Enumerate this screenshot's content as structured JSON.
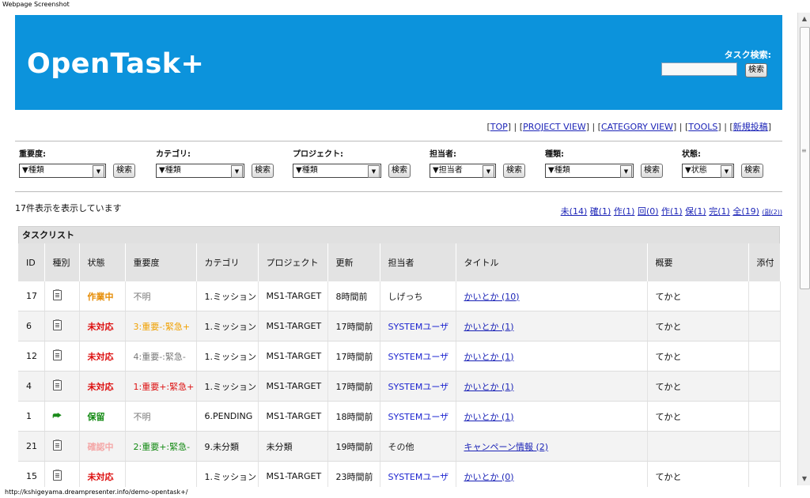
{
  "window": {
    "title": "Webpage Screenshot",
    "status_url": "http://kshigeyama.dreampresenter.info/demo-opentask+/"
  },
  "header": {
    "logo": "OpenTask+",
    "search_label": "タスク検索:",
    "search_button": "検索",
    "search_value": ""
  },
  "nav": [
    {
      "label": "TOP"
    },
    {
      "label": "PROJECT VIEW"
    },
    {
      "label": "CATEGORY VIEW"
    },
    {
      "label": "TOOLS"
    },
    {
      "label": "新規投稿"
    }
  ],
  "filters": [
    {
      "label": "重要度:",
      "value": "▼種類",
      "button": "検索"
    },
    {
      "label": "カテゴリ:",
      "value": "▼種類",
      "button": "検索"
    },
    {
      "label": "プロジェクト:",
      "value": "▼種類",
      "button": "検索"
    },
    {
      "label": "担当者:",
      "value": "▼担当者",
      "button": "検索"
    },
    {
      "label": "種類:",
      "value": "▼種類",
      "button": "検索"
    },
    {
      "label": "状態:",
      "value": "▼状態",
      "button": "検索"
    }
  ],
  "count_text": "17件表示を表示しています",
  "status_links": [
    {
      "label": "未(14)"
    },
    {
      "label": "確(1)"
    },
    {
      "label": "作(1)"
    },
    {
      "label": "回(0)"
    },
    {
      "label": "作(1)"
    },
    {
      "label": "保(1)"
    },
    {
      "label": "完(1)"
    },
    {
      "label": "全(19)"
    },
    {
      "label": "(副(2))",
      "small": true
    }
  ],
  "tasklist": {
    "title": "タスクリスト",
    "columns": [
      "ID",
      "種別",
      "状態",
      "重要度",
      "カテゴリ",
      "プロジェクト",
      "更新",
      "担当者",
      "タイトル",
      "概要",
      "添付"
    ],
    "rows": [
      {
        "id": "17",
        "icon": "document-icon",
        "status": "作業中",
        "status_color": "#e58a00",
        "priority": "不明",
        "priority_color": "#777777",
        "category": "1.ミッション",
        "project": "MS1-TARGET",
        "updated": "8時間前",
        "assignee": "しげっち",
        "assignee_color": "#222222",
        "title": "かいとか (10)",
        "summary": "てかと"
      },
      {
        "id": "6",
        "icon": "document-icon",
        "status": "未対応",
        "status_color": "#dd1111",
        "priority": "3:重要-:緊急+",
        "priority_color": "#f0a000",
        "category": "1.ミッション",
        "project": "MS1-TARGET",
        "updated": "17時間前",
        "assignee": "SYSTEMユーザ",
        "assignee_color": "#1c24d0",
        "title": "かいとか (1)",
        "summary": "てかと"
      },
      {
        "id": "12",
        "icon": "document-icon",
        "status": "未対応",
        "status_color": "#dd1111",
        "priority": "4:重要-:緊急-",
        "priority_color": "#777777",
        "category": "1.ミッション",
        "project": "MS1-TARGET",
        "updated": "17時間前",
        "assignee": "SYSTEMユーザ",
        "assignee_color": "#1c24d0",
        "title": "かいとか (1)",
        "summary": "てかと"
      },
      {
        "id": "4",
        "icon": "document-icon",
        "status": "未対応",
        "status_color": "#dd1111",
        "priority": "1:重要+:緊急+",
        "priority_color": "#dd1111",
        "category": "1.ミッション",
        "project": "MS1-TARGET",
        "updated": "17時間前",
        "assignee": "SYSTEMユーザ",
        "assignee_color": "#1c24d0",
        "title": "かいとか (1)",
        "summary": "てかと"
      },
      {
        "id": "1",
        "icon": "reply-arrow-icon",
        "status": "保留",
        "status_color": "#138a13",
        "priority": "不明",
        "priority_color": "#777777",
        "category": "6.PENDING",
        "project": "MS1-TARGET",
        "updated": "18時間前",
        "assignee": "SYSTEMユーザ",
        "assignee_color": "#1c24d0",
        "title": "かいとか (1)",
        "summary": "てかと"
      },
      {
        "id": "21",
        "icon": "document-icon",
        "status": "確認中",
        "status_color": "#f4a7a7",
        "priority": "2:重要+:緊急-",
        "priority_color": "#138a13",
        "category": "9.未分類",
        "project": "未分類",
        "updated": "19時間前",
        "assignee": "その他",
        "assignee_color": "#222222",
        "title": "キャンペーン情報 (2)",
        "summary": ""
      },
      {
        "id": "15",
        "icon": "document-icon",
        "status": "未対応",
        "status_color": "#dd1111",
        "priority": "",
        "priority_color": "#777777",
        "category": "1.ミッション",
        "project": "MS1-TARGET",
        "updated": "23時間前",
        "assignee": "SYSTEMユーザ",
        "assignee_color": "#1c24d0",
        "title": "かいとか (0)",
        "summary": "てかと"
      }
    ]
  }
}
